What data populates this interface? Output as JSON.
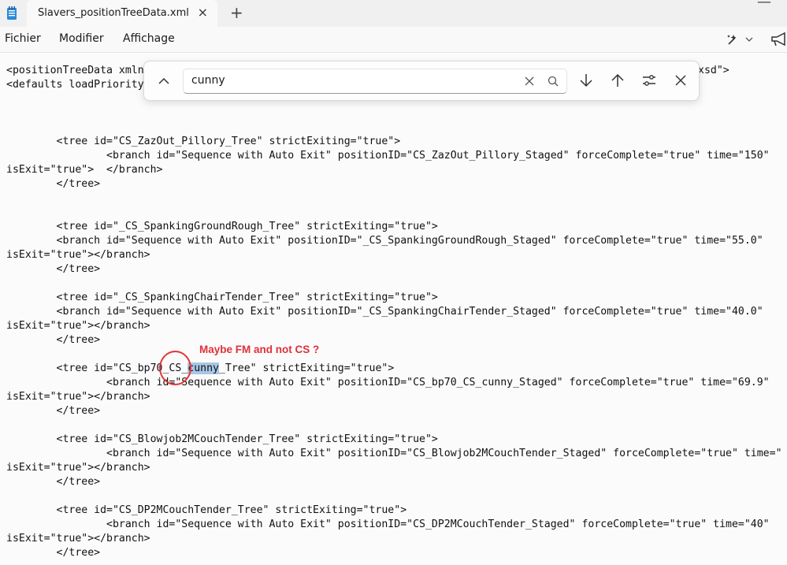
{
  "window": {
    "tab_title": "Slavers_positionTreeData.xml",
    "app_icon": "notepad-icon",
    "tab_close": "×",
    "new_tab": "+"
  },
  "menu": {
    "fichier": "Fichier",
    "modifier": "Modifier",
    "affichage": "Affichage"
  },
  "find": {
    "query": "cunny"
  },
  "code_lines": [
    "<positionTreeData xmln",
    "<defaults loadPriority",
    "xsd\">",
    "        <tree id=\"CS_ZazOut_Pillory_Tree\" strictExiting=\"true\">",
    "                <branch id=\"Sequence with Auto Exit\" positionID=\"CS_ZazOut_Pillory_Staged\" forceComplete=\"true\" time=\"150\"",
    "isExit=\"true\">  </branch>",
    "        </tree>",
    "        <tree id=\"_CS_SpankingGroundRough_Tree\" strictExiting=\"true\">",
    "        <branch id=\"Sequence with Auto Exit\" positionID=\"_CS_SpankingGroundRough_Staged\" forceComplete=\"true\" time=\"55.0\"",
    "isExit=\"true\"></branch>",
    "        </tree>",
    "        <tree id=\"_CS_SpankingChairTender_Tree\" strictExiting=\"true\">",
    "        <branch id=\"Sequence with Auto Exit\" positionID=\"_CS_SpankingChairTender_Staged\" forceComplete=\"true\" time=\"40.0\"",
    "isExit=\"true\"></branch>",
    "        </tree>",
    "        <tree id=\"CS_bp70_CS_",
    "cunny",
    "_Tree\" strictExiting=\"true\">",
    "                <branch id=\"Sequence with Auto Exit\" positionID=\"CS_bp70_CS_cunny_Staged\" forceComplete=\"true\" time=\"69.9\"",
    "isExit=\"true\"></branch>",
    "        </tree>",
    "        <tree id=\"CS_Blowjob2MCouchTender_Tree\" strictExiting=\"true\">",
    "                <branch id=\"Sequence with Auto Exit\" positionID=\"CS_Blowjob2MCouchTender_Staged\" forceComplete=\"true\" time=\"",
    "isExit=\"true\"></branch>",
    "        </tree>",
    "        <tree id=\"CS_DP2MCouchTender_Tree\" strictExiting=\"true\">",
    "                <branch id=\"Sequence with Auto Exit\" positionID=\"CS_DP2MCouchTender_Staged\" forceComplete=\"true\" time=\"40\"",
    "isExit=\"true\"></branch>",
    "        </tree>"
  ],
  "annotation": {
    "text": "Maybe FM and not CS ?",
    "color": "#e0303a"
  },
  "icons": {
    "collapse": "chevron-up-icon",
    "clear": "clear-icon",
    "search": "search-icon",
    "next": "arrow-down-icon",
    "previous": "arrow-up-icon",
    "options": "options-icon",
    "close": "close-icon"
  }
}
